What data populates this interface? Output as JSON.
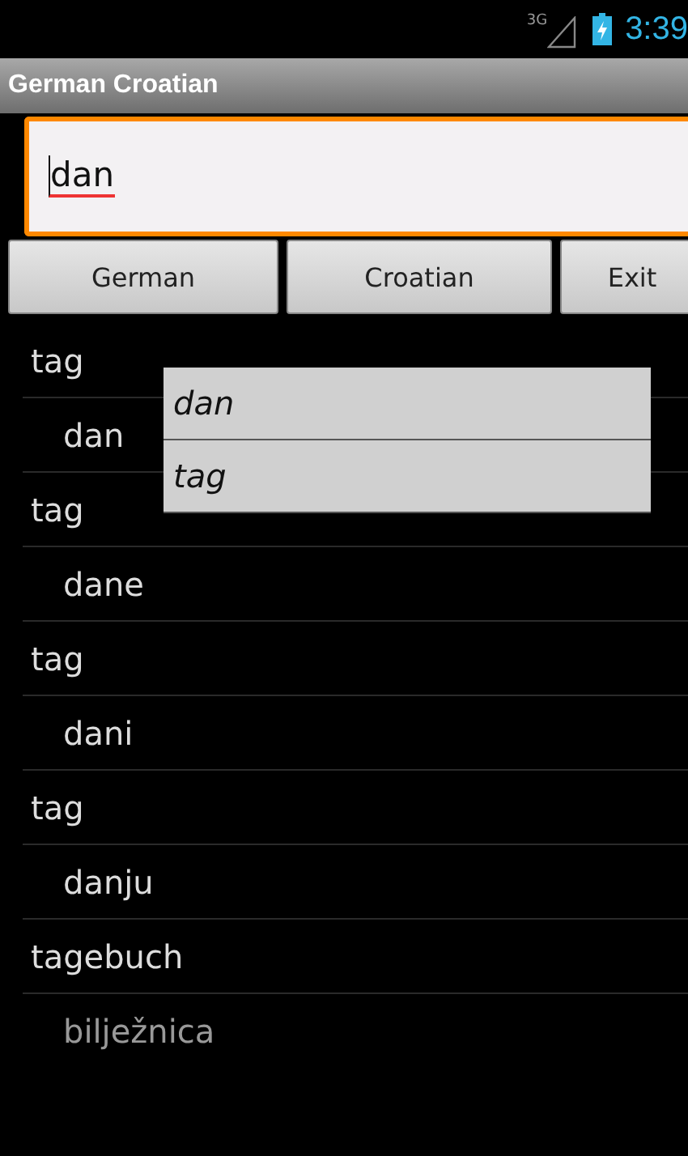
{
  "status_bar": {
    "network": "3G",
    "time": "3:39"
  },
  "window": {
    "title": "German Croatian"
  },
  "search": {
    "value": "dan"
  },
  "buttons": [
    "German",
    "Croatian",
    "Exit"
  ],
  "results": [
    {
      "kind": "word",
      "text": "tag"
    },
    {
      "kind": "translation",
      "text": "dan"
    },
    {
      "kind": "word",
      "text": "tag"
    },
    {
      "kind": "translation",
      "text": "dane"
    },
    {
      "kind": "word",
      "text": "tag"
    },
    {
      "kind": "translation",
      "text": "dani"
    },
    {
      "kind": "word",
      "text": "tag"
    },
    {
      "kind": "translation",
      "text": "danju"
    },
    {
      "kind": "word",
      "text": "tagebuch"
    },
    {
      "kind": "translation",
      "text": "bilježnica"
    }
  ],
  "suggestions": [
    "dan",
    "tag"
  ]
}
